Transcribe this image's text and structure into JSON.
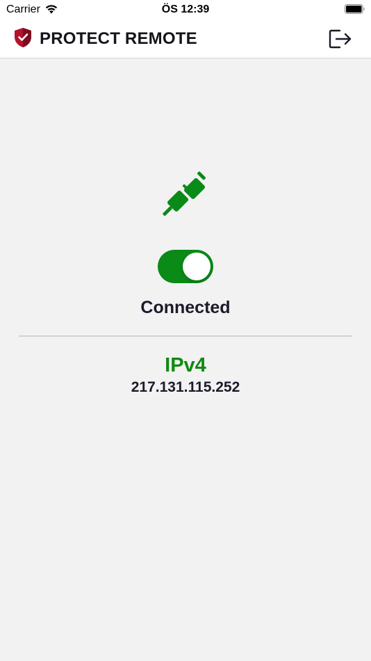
{
  "status_bar": {
    "carrier": "Carrier",
    "time": "ÖS 12:39"
  },
  "header": {
    "title": "PROTECT REMOTE",
    "logo_icon": "shield-check-icon",
    "logout_icon": "logout-icon"
  },
  "connection": {
    "icon": "plug-icon",
    "toggle_on": true,
    "status": "Connected",
    "ip_label": "IPv4",
    "ip_address": "217.131.115.252"
  },
  "colors": {
    "accent_green": "#0a8a17",
    "logo_red": "#b0152b",
    "background": "#f2f2f2"
  }
}
